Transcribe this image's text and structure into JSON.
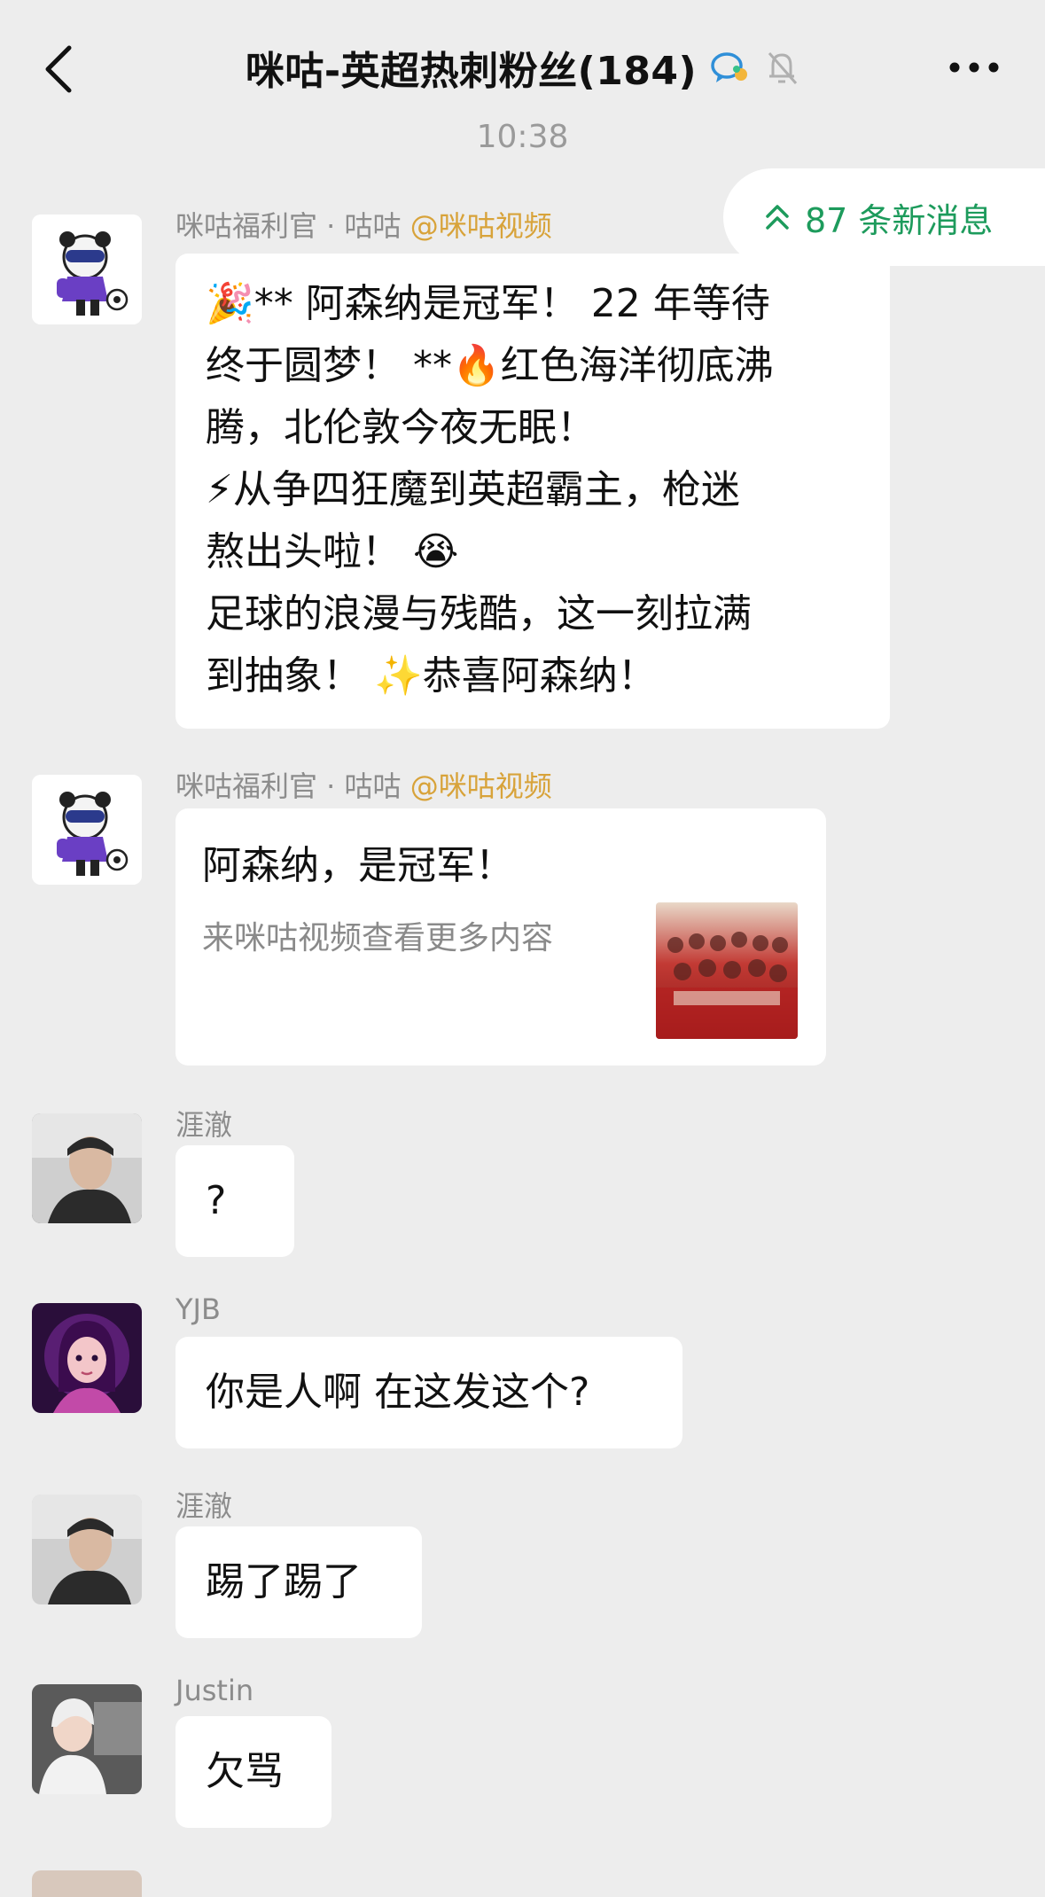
{
  "header": {
    "title": "咪咕-英超热刺粉丝(184)",
    "back_icon": "chevron-left-icon",
    "chat_icon": "group-chat-icon",
    "mute_icon": "bell-off-icon",
    "more_icon": "more-dots-icon"
  },
  "timestamp": "10:38",
  "new_messages": {
    "label": "87 条新消息",
    "icon": "double-chevron-up-icon"
  },
  "messages": [
    {
      "sender": "咪咕福利官 · 咕咕",
      "source": "@咪咕视频",
      "lines": [
        "🎉** 阿森纳是冠军！ 22 年等待",
        "终于圆梦！ **🔥红色海洋彻底沸",
        "腾，北伦敦今夜无眠！",
        "⚡从争四狂魔到英超霸主，枪迷",
        "熬出头啦！ 😭",
        "足球的浪漫与残酷，这一刻拉满",
        "到抽象！ ✨恭喜阿森纳！"
      ]
    },
    {
      "sender": "咪咕福利官 · 咕咕",
      "source": "@咪咕视频",
      "card": {
        "title": "阿森纳，是冠军！",
        "subtitle": "来咪咕视频查看更多内容"
      }
    },
    {
      "sender": "涯澈",
      "text": "?"
    },
    {
      "sender": "YJB",
      "text": "你是人啊 在这发这个?"
    },
    {
      "sender": "涯澈",
      "text": "踢了踢了"
    },
    {
      "sender": "Justin",
      "text": "欠骂"
    }
  ],
  "colors": {
    "background": "#ededed",
    "bubble": "#ffffff",
    "accent_green": "#1d9b5c",
    "source_gold": "#d8a33a"
  }
}
